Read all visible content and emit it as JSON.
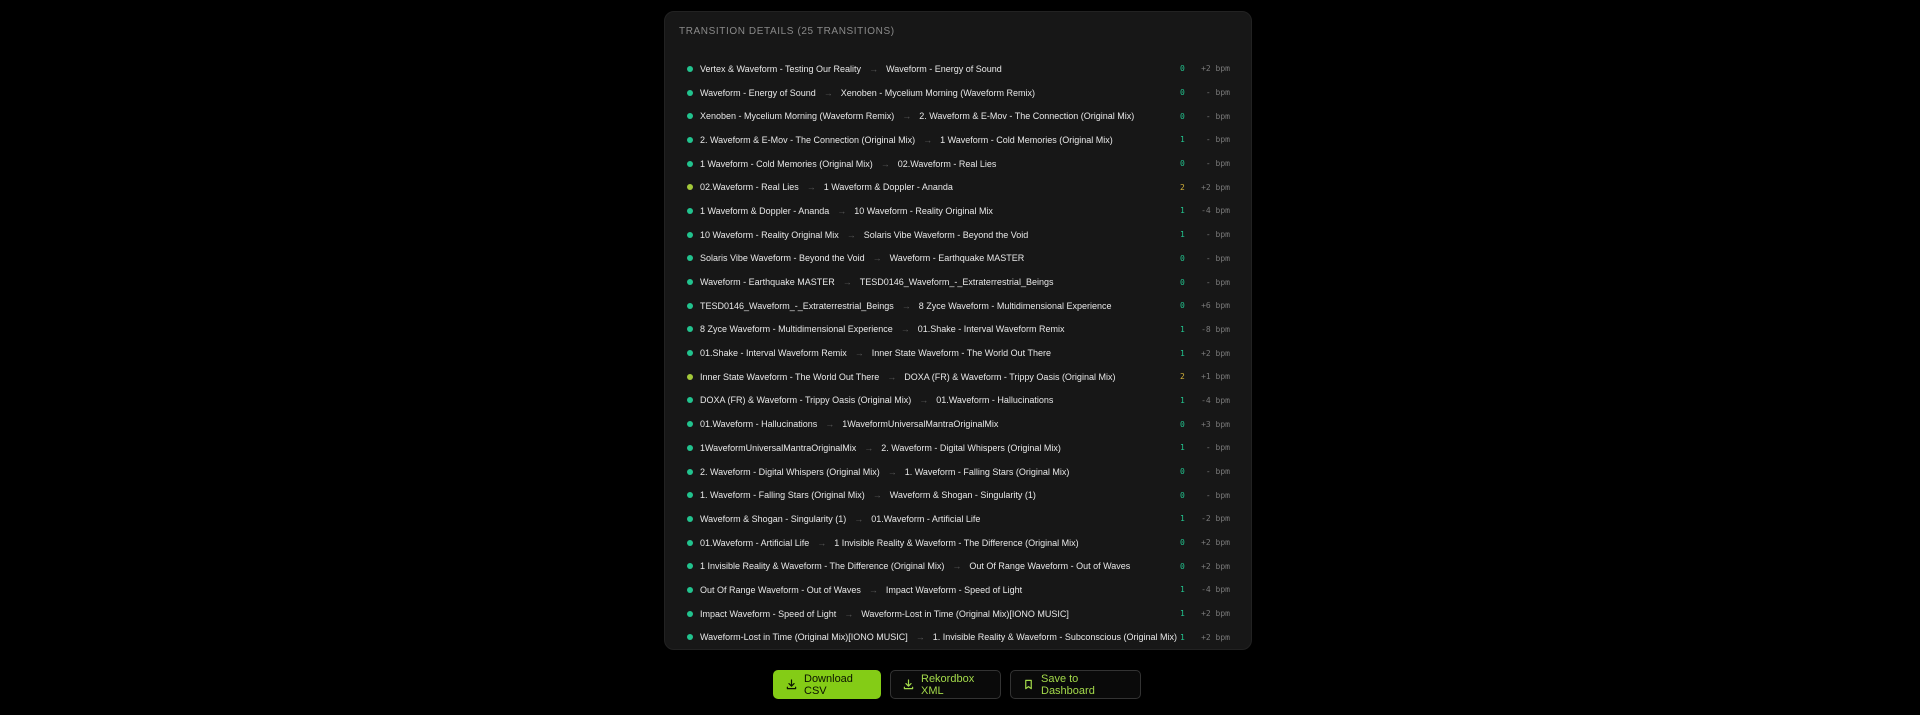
{
  "panel": {
    "title": "TRANSITION DETAILS (25 TRANSITIONS)"
  },
  "transitions": [
    {
      "from": "Vertex & Waveform - Testing Our Reality",
      "to": "Waveform - Energy of Sound",
      "score": "0",
      "bpm": "+2 bpm",
      "status": "ok"
    },
    {
      "from": "Waveform - Energy of Sound",
      "to": "Xenoben - Mycelium Morning (Waveform Remix)",
      "score": "0",
      "bpm": "- bpm",
      "status": "ok"
    },
    {
      "from": "Xenoben - Mycelium Morning (Waveform Remix)",
      "to": "2. Waveform & E-Mov - The Connection (Original Mix)",
      "score": "0",
      "bpm": "- bpm",
      "status": "ok"
    },
    {
      "from": "2. Waveform & E-Mov - The Connection (Original Mix)",
      "to": "1 Waveform - Cold Memories (Original Mix)",
      "score": "1",
      "bpm": "- bpm",
      "status": "ok"
    },
    {
      "from": "1 Waveform - Cold Memories (Original Mix)",
      "to": "02.Waveform - Real Lies",
      "score": "0",
      "bpm": "- bpm",
      "status": "ok"
    },
    {
      "from": "02.Waveform - Real Lies",
      "to": "1 Waveform & Doppler - Ananda",
      "score": "2",
      "bpm": "+2 bpm",
      "status": "warn"
    },
    {
      "from": "1 Waveform & Doppler - Ananda",
      "to": "10 Waveform - Reality Original Mix",
      "score": "1",
      "bpm": "-4 bpm",
      "status": "ok"
    },
    {
      "from": "10 Waveform - Reality Original Mix",
      "to": "Solaris Vibe Waveform - Beyond the Void",
      "score": "1",
      "bpm": "- bpm",
      "status": "ok"
    },
    {
      "from": "Solaris Vibe Waveform - Beyond the Void",
      "to": "Waveform - Earthquake MASTER",
      "score": "0",
      "bpm": "- bpm",
      "status": "ok"
    },
    {
      "from": "Waveform - Earthquake MASTER",
      "to": "TESD0146_Waveform_-_Extraterrestrial_Beings",
      "score": "0",
      "bpm": "- bpm",
      "status": "ok"
    },
    {
      "from": "TESD0146_Waveform_-_Extraterrestrial_Beings",
      "to": "8 Zyce Waveform - Multidimensional Experience",
      "score": "0",
      "bpm": "+6 bpm",
      "status": "ok"
    },
    {
      "from": "8 Zyce Waveform - Multidimensional Experience",
      "to": "01.Shake - Interval Waveform Remix",
      "score": "1",
      "bpm": "-8 bpm",
      "status": "ok"
    },
    {
      "from": "01.Shake - Interval Waveform Remix",
      "to": "Inner State Waveform - The World Out There",
      "score": "1",
      "bpm": "+2 bpm",
      "status": "ok"
    },
    {
      "from": "Inner State Waveform - The World Out There",
      "to": "DOXA (FR) & Waveform - Trippy Oasis (Original Mix)",
      "score": "2",
      "bpm": "+1 bpm",
      "status": "warn"
    },
    {
      "from": "DOXA (FR) & Waveform - Trippy Oasis (Original Mix)",
      "to": "01.Waveform - Hallucinations",
      "score": "1",
      "bpm": "-4 bpm",
      "status": "ok"
    },
    {
      "from": "01.Waveform - Hallucinations",
      "to": "1WaveformUniversalMantraOriginalMix",
      "score": "0",
      "bpm": "+3 bpm",
      "status": "ok"
    },
    {
      "from": "1WaveformUniversalMantraOriginalMix",
      "to": "2. Waveform - Digital Whispers (Original Mix)",
      "score": "1",
      "bpm": "- bpm",
      "status": "ok"
    },
    {
      "from": "2. Waveform - Digital Whispers (Original Mix)",
      "to": "1. Waveform - Falling Stars (Original Mix)",
      "score": "0",
      "bpm": "- bpm",
      "status": "ok"
    },
    {
      "from": "1. Waveform - Falling Stars (Original Mix)",
      "to": "Waveform & Shogan - Singularity (1)",
      "score": "0",
      "bpm": "- bpm",
      "status": "ok"
    },
    {
      "from": "Waveform & Shogan - Singularity (1)",
      "to": "01.Waveform - Artificial Life",
      "score": "1",
      "bpm": "-2 bpm",
      "status": "ok"
    },
    {
      "from": "01.Waveform - Artificial Life",
      "to": "1 Invisible Reality & Waveform - The Difference (Original Mix)",
      "score": "0",
      "bpm": "+2 bpm",
      "status": "ok"
    },
    {
      "from": "1 Invisible Reality & Waveform - The Difference (Original Mix)",
      "to": "Out Of Range Waveform - Out of Waves",
      "score": "0",
      "bpm": "+2 bpm",
      "status": "ok"
    },
    {
      "from": "Out Of Range Waveform - Out of Waves",
      "to": "Impact Waveform - Speed of Light",
      "score": "1",
      "bpm": "-4 bpm",
      "status": "ok"
    },
    {
      "from": "Impact Waveform - Speed of Light",
      "to": "Waveform-Lost in Time (Original Mix)[IONO MUSIC]",
      "score": "1",
      "bpm": "+2 bpm",
      "status": "ok"
    },
    {
      "from": "Waveform-Lost in Time (Original Mix)[IONO MUSIC]",
      "to": "1. Invisible Reality & Waveform - Subconscious (Original Mix)",
      "score": "1",
      "bpm": "+2 bpm",
      "status": "ok"
    }
  ],
  "arrow": "→",
  "actions": {
    "download_csv": "Download CSV",
    "rekordbox_xml": "Rekordbox XML",
    "save_dashboard": "Save to Dashboard"
  },
  "colors": {
    "accent": "#84cc16",
    "ok_dot": "#22c38e",
    "warn_dot": "#a3c93a",
    "warn_score": "#d2b03a"
  }
}
